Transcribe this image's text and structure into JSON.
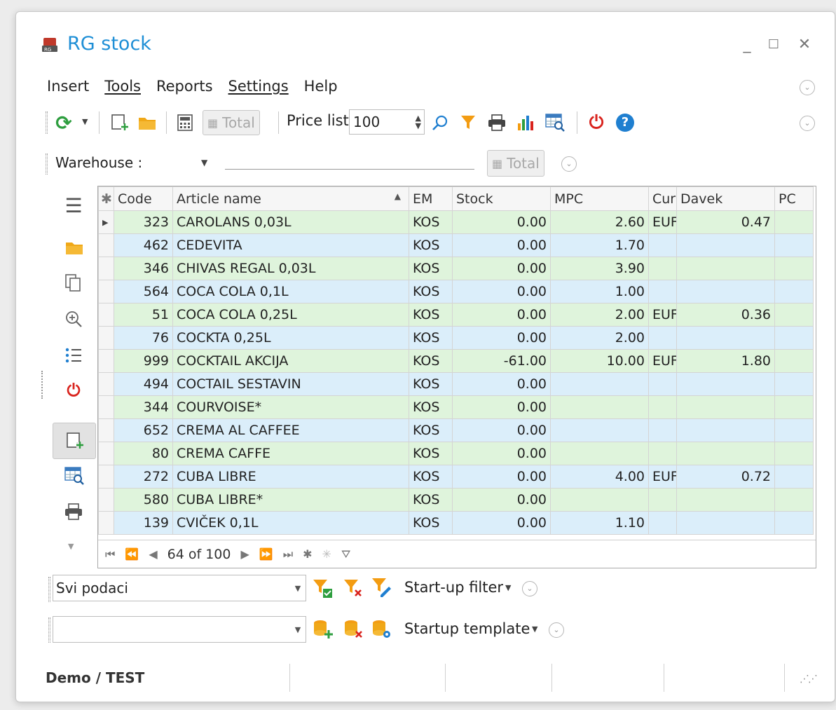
{
  "window": {
    "title": "RG stock",
    "minimize": "_",
    "maximize": "☐",
    "close": "✕"
  },
  "menu": [
    "Insert",
    "Tools",
    "Reports",
    "Settings",
    "Help"
  ],
  "toolbar": {
    "total_label": "Total",
    "price_list_label": "Price list",
    "price_list_value": "100"
  },
  "warehouse": {
    "label": "Warehouse :",
    "value": "",
    "total_label": "Total"
  },
  "grid": {
    "columns": [
      "Code",
      "Article name",
      "EM",
      "Stock",
      "MPC",
      "Cur",
      "Davek",
      "PC"
    ],
    "rows": [
      [
        "323",
        "CAROLANS 0,03L",
        "KOS",
        "0.00",
        "2.60",
        "EUF",
        "0.47",
        ""
      ],
      [
        "462",
        "CEDEVITA",
        "KOS",
        "0.00",
        "1.70",
        "",
        "",
        ""
      ],
      [
        "346",
        "CHIVAS REGAL 0,03L",
        "KOS",
        "0.00",
        "3.90",
        "",
        "",
        ""
      ],
      [
        "564",
        "COCA COLA 0,1L",
        "KOS",
        "0.00",
        "1.00",
        "",
        "",
        ""
      ],
      [
        "51",
        "COCA COLA 0,25L",
        "KOS",
        "0.00",
        "2.00",
        "EUF",
        "0.36",
        ""
      ],
      [
        "76",
        "COCKTA 0,25L",
        "KOS",
        "0.00",
        "2.00",
        "",
        "",
        ""
      ],
      [
        "999",
        "COCKTAIL AKCIJA",
        "KOS",
        "-61.00",
        "10.00",
        "EUF",
        "1.80",
        ""
      ],
      [
        "494",
        "COCTAIL SESTAVIN",
        "KOS",
        "0.00",
        "",
        "",
        "",
        ""
      ],
      [
        "344",
        "COURVOISE*",
        "KOS",
        "0.00",
        "",
        "",
        "",
        ""
      ],
      [
        "652",
        "CREMA AL CAFFEE",
        "KOS",
        "0.00",
        "",
        "",
        "",
        ""
      ],
      [
        "80",
        "CREMA CAFFE",
        "KOS",
        "0.00",
        "",
        "",
        "",
        ""
      ],
      [
        "272",
        "CUBA LIBRE",
        "KOS",
        "0.00",
        "4.00",
        "EUF",
        "0.72",
        ""
      ],
      [
        "580",
        "CUBA LIBRE*",
        "KOS",
        "0.00",
        "",
        "",
        "",
        ""
      ],
      [
        "139",
        "CVIČEK 0,1L",
        "KOS",
        "0.00",
        "1.10",
        "",
        "",
        ""
      ]
    ],
    "navigator_text": "64 of 100"
  },
  "filter": {
    "combo_value": "Svi podaci",
    "startup_filter_label": "Start-up filter"
  },
  "template": {
    "combo_value": "",
    "startup_template_label": "Startup template"
  },
  "status": {
    "text": "Demo / TEST"
  },
  "colors": {
    "title_blue": "#1f8fd6",
    "row_green": "#dff4dc",
    "row_blue": "#dbeefa",
    "power_red": "#d9231d",
    "filter_orange": "#f39c12"
  }
}
